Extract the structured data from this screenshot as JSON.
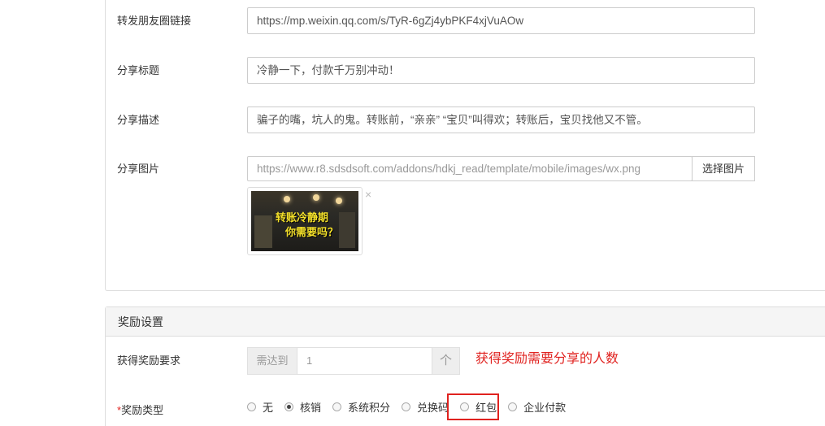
{
  "top_form": {
    "moments_link": {
      "label": "转发朋友圈链接",
      "value": "https://mp.weixin.qq.com/s/TyR-6gZj4ybPKF4xjVuAOw"
    },
    "share_title": {
      "label": "分享标题",
      "value": "冷静一下，付款千万别冲动！"
    },
    "share_desc": {
      "label": "分享描述",
      "value": "骗子的嘴，坑人的鬼。转账前，“亲亲” “宝贝”叫得欢；转账后，宝贝找他又不管。"
    },
    "share_image": {
      "label": "分享图片",
      "value": "https://www.r8.sdsdsoft.com/addons/hdkj_read/template/mobile/images/wx.png",
      "pick_button": "选择图片",
      "thumb_line1": "转账冷静期",
      "thumb_line2": "你需要吗？",
      "remove_glyph": "×"
    }
  },
  "reward": {
    "heading": "奖励设置",
    "requirement": {
      "label": "获得奖励要求",
      "prefix": "需达到",
      "value": "1",
      "suffix": "个",
      "hint": "获得奖励需要分享的人数"
    },
    "type": {
      "required_mark": "*",
      "label": "奖励类型",
      "options": [
        {
          "label": "无",
          "checked": false
        },
        {
          "label": "核销",
          "checked": true
        },
        {
          "label": "系统积分",
          "checked": false
        },
        {
          "label": "兑换码",
          "checked": false
        },
        {
          "label": "红包",
          "checked": false
        },
        {
          "label": "企业付款",
          "checked": false
        }
      ]
    }
  },
  "colors": {
    "accent_red": "#e0221f",
    "panel_heading_bg": "#f5f5f5",
    "border": "#dddddd"
  }
}
